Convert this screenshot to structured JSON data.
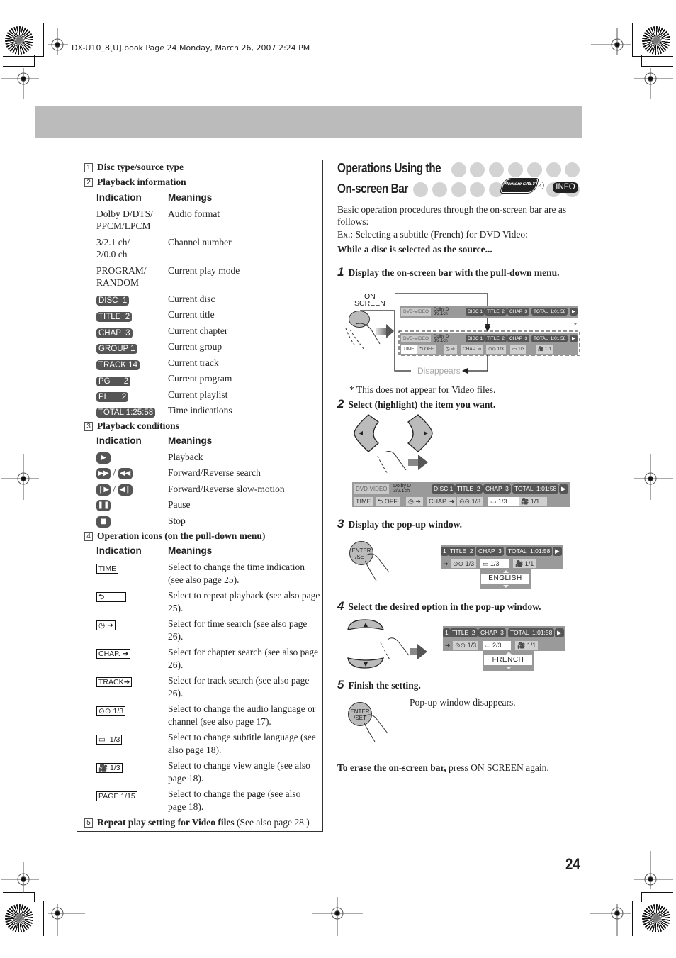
{
  "header_meta": "DX-U10_8[U].book  Page 24  Monday, March 26, 2007  2:24 PM",
  "page_number": "24",
  "left_panel": {
    "sections": [
      {
        "num": "1",
        "title": "Disc type/source type"
      },
      {
        "num": "2",
        "title": "Playback information"
      },
      {
        "num": "3",
        "title": "Playback conditions"
      },
      {
        "num": "4",
        "title": "Operation icons (on the pull-down menu)"
      },
      {
        "num": "5",
        "title": "Repeat play setting for Video files",
        "note": " (See also page 28.)"
      }
    ],
    "col_indication": "Indication",
    "col_meanings": "Meanings",
    "playback_info": [
      {
        "ind": "Dolby D/DTS/\nPPCM/LPCM",
        "mean": "Audio format"
      },
      {
        "ind": "3/2.1 ch/\n2/0.0 ch",
        "mean": "Channel number"
      },
      {
        "ind": "PROGRAM/\nRANDOM",
        "mean": "Current play mode"
      },
      {
        "ind": "DISC  1",
        "mean": "Current disc"
      },
      {
        "ind": "TITLE  2",
        "mean": "Current title"
      },
      {
        "ind": "CHAP  3",
        "mean": "Current chapter"
      },
      {
        "ind": "GROUP 1",
        "mean": "Current group"
      },
      {
        "ind": "TRACK 14",
        "mean": "Current track"
      },
      {
        "ind": "PG      2",
        "mean": "Current program"
      },
      {
        "ind": "PL      2",
        "mean": "Current playlist"
      },
      {
        "ind": "TOTAL 1:25:58",
        "mean": "Time indications"
      }
    ],
    "playback_conditions": [
      {
        "icon": "play-icon",
        "mean": "Playback"
      },
      {
        "icon": "search-icon",
        "mean": "Forward/Reverse search"
      },
      {
        "icon": "slow-motion-icon",
        "mean": "Forward/Reverse slow-motion"
      },
      {
        "icon": "pause-icon",
        "mean": "Pause"
      },
      {
        "icon": "stop-icon",
        "mean": "Stop"
      }
    ],
    "operation_icons": [
      {
        "ind": "TIME",
        "mean": "Select to change the time indication (see also page 25)."
      },
      {
        "ind": "⮌",
        "mean": "Select to repeat playback (see also page 25)."
      },
      {
        "ind": "◷ ➜",
        "mean": "Select for time search (see also page 26)."
      },
      {
        "ind": "CHAP. ➜",
        "mean": "Select for chapter search (see also page 26)."
      },
      {
        "ind": "TRACK➜",
        "mean": "Select for track search (see also page 26)."
      },
      {
        "ind": "⊙⊙ 1/3",
        "mean": "Select to change the audio language or channel (see also page 17)."
      },
      {
        "ind": "▭  1/3",
        "mean": "Select to change subtitle language (see also page 18)."
      },
      {
        "ind": "🎥 1/3",
        "mean": "Select to change view angle (see also page 18)."
      },
      {
        "ind": "PAGE 1/15",
        "mean": "Select to change the page (see also page 18)."
      }
    ]
  },
  "right_panel": {
    "title_line1": "Operations Using the",
    "title_line2": "On-screen Bar",
    "remote_badge": "Remote ONLY",
    "info_badge": "INFO",
    "intro": "Basic operation procedures through the on-screen bar are as follows:",
    "example": "Ex.: Selecting a subtitle (French) for DVD Video:",
    "precondition": "While a disc is selected as the source...",
    "steps": [
      {
        "num": "1",
        "text": "Display the on-screen bar with the pull-down menu."
      },
      {
        "num": "2",
        "text": "Select (highlight) the item you want."
      },
      {
        "num": "3",
        "text": "Display the pop-up window."
      },
      {
        "num": "4",
        "text": "Select the desired option in the pop-up window."
      },
      {
        "num": "5",
        "text": "Finish the setting."
      }
    ],
    "on_screen_label": "ON\nSCREEN",
    "disappears_label": "Disappears",
    "asterisk": "*",
    "footnote": "* This does not appear for Video files.",
    "enter_set_label": "ENTER\n/SET",
    "step5_note": "Pop-up window disappears.",
    "erase_bold": "To erase the on-screen bar,",
    "erase_rest": " press ON SCREEN again.",
    "bar": {
      "source": "DVD-VIDEO",
      "audio": "Dolby D",
      "channel": "3/2.1ch",
      "disc": "DISC 1",
      "title": "TITLE  2",
      "chap": "CHAP  3",
      "total": "TOTAL  1:01:58",
      "time_btn": "TIME",
      "repeat_btn": "⮌ OFF",
      "timesearch_btn": "◷ ➜",
      "chap_btn": "CHAP. ➜",
      "audio_btn": "⊙⊙ 1/3",
      "subtitle_btn": "▭ 1/3",
      "subtitle_btn_after": "▭ 2/3",
      "angle_btn": "🎥 1/1"
    },
    "popup_step3": "ENGLISH",
    "popup_step4": "FRENCH"
  }
}
